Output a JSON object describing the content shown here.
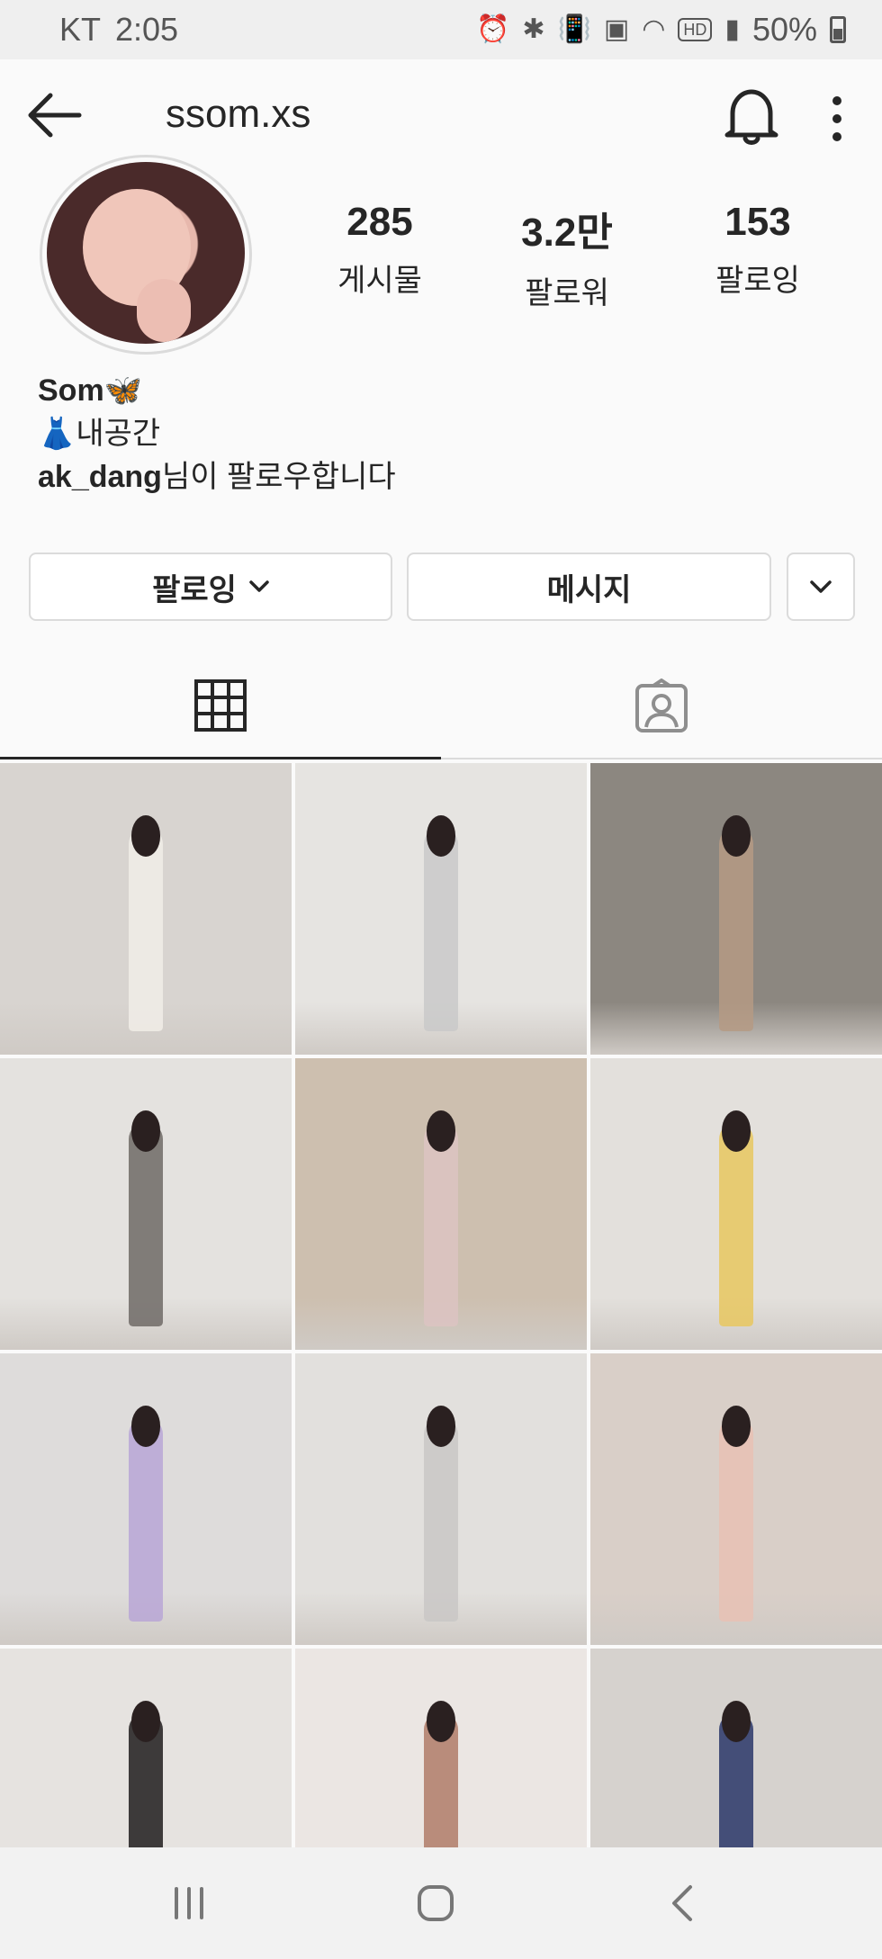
{
  "status_bar": {
    "carrier": "KT",
    "time": "2:05",
    "battery": "50%",
    "icons": [
      "alarm-icon",
      "bluetooth-icon",
      "vibrate-icon",
      "nfc-icon",
      "wifi-icon",
      "hd-icon",
      "signal-icon",
      "battery-icon"
    ]
  },
  "header": {
    "username": "ssom.xs",
    "icons": [
      "back-arrow-icon",
      "bell-icon",
      "more-vertical-icon"
    ]
  },
  "profile": {
    "stats": [
      {
        "value": "285",
        "label": "게시물"
      },
      {
        "value": "3.2만",
        "label": "팔로워"
      },
      {
        "value": "153",
        "label": "팔로잉"
      }
    ],
    "bio": {
      "name": "Som🦋",
      "line2": "👗내공간",
      "followed_by_user": "ak_dang",
      "followed_by_suffix": "님이 팔로우합니다"
    }
  },
  "actions": {
    "following_label": "팔로잉",
    "message_label": "메시지"
  },
  "tabs": [
    {
      "icon": "grid-icon",
      "selected": true
    },
    {
      "icon": "tagged-person-icon",
      "selected": false
    }
  ],
  "grid_photos": [
    {
      "bg": "#d8d4d0",
      "fig": "#f1ede8"
    },
    {
      "bg": "#e6e4e1",
      "fig": "#c9c9c9"
    },
    {
      "bg": "#8c8780",
      "fig": "#b59a84"
    },
    {
      "bg": "#e4e2df",
      "fig": "#6f6a66"
    },
    {
      "bg": "#cdbfaf",
      "fig": "#dcc3c2"
    },
    {
      "bg": "#e3e0dc",
      "fig": "#e8c75f"
    },
    {
      "bg": "#dedcdb",
      "fig": "#b8a6d6"
    },
    {
      "bg": "#e2e0dd",
      "fig": "#c9c7c5"
    },
    {
      "bg": "#d9cfc8",
      "fig": "#e8c1b4"
    },
    {
      "bg": "#e6e3e0",
      "fig": "#1f1c1c"
    },
    {
      "bg": "#ebe6e3",
      "fig": "#b07b68"
    },
    {
      "bg": "#d6d2ce",
      "fig": "#2a3769"
    }
  ]
}
